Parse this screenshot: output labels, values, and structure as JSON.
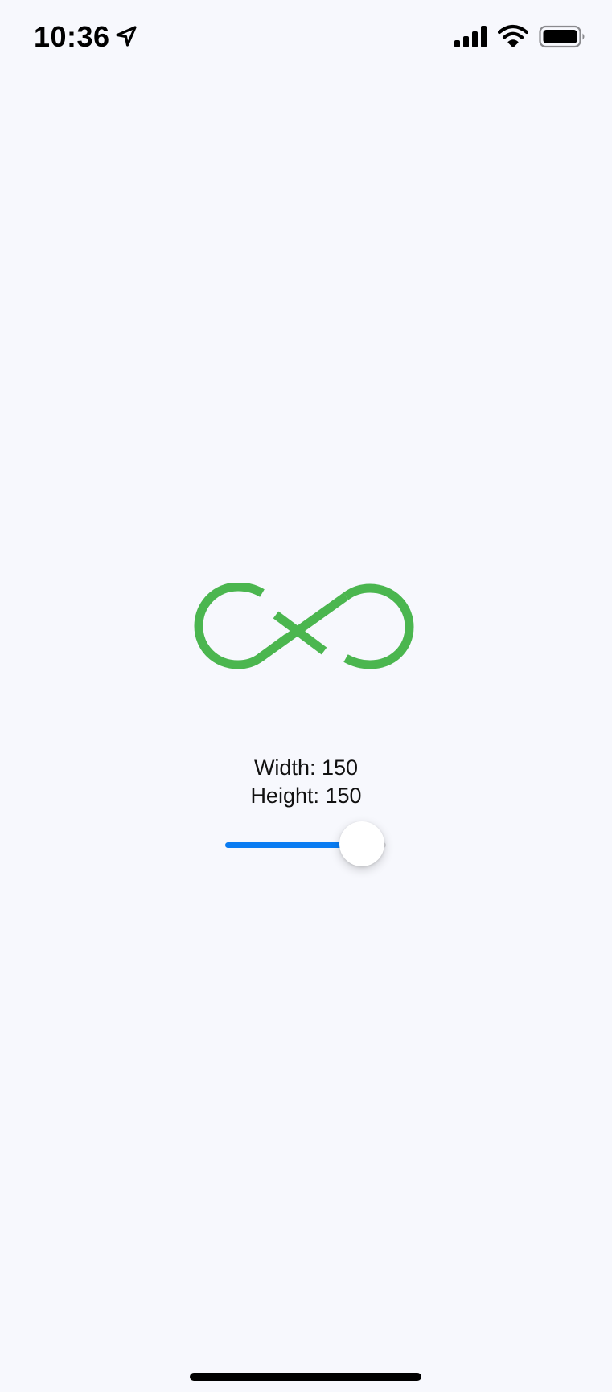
{
  "status_bar": {
    "time": "10:36",
    "icons": [
      "location-arrow-icon",
      "cellular-signal-icon",
      "wifi-icon",
      "battery-icon"
    ]
  },
  "logo": {
    "icon": "infinity-logo",
    "color": "#4bb64f"
  },
  "dimensions": {
    "width_label": "Width: 150",
    "height_label": "Height: 150"
  },
  "slider": {
    "value_fraction": 0.85,
    "accent_color": "#0a7cf2"
  }
}
